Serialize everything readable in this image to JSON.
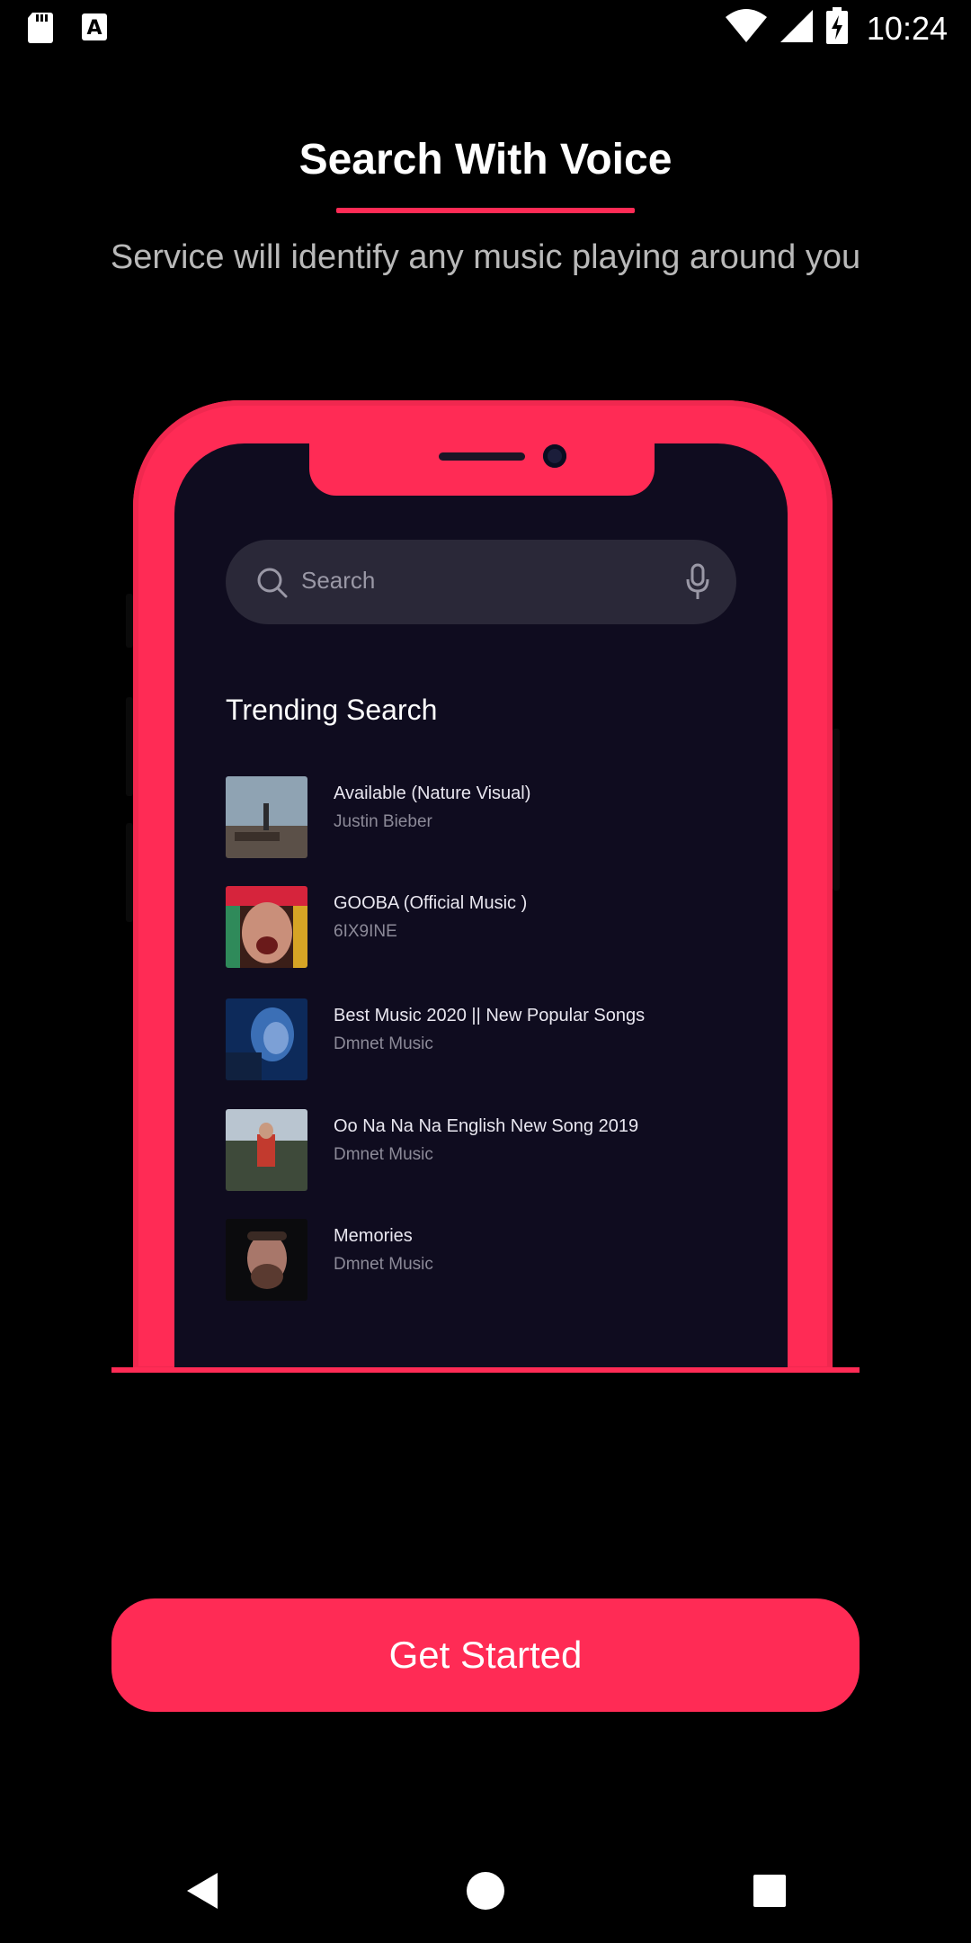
{
  "status_bar": {
    "time": "10:24",
    "icons": [
      "sd-card-icon",
      "a-notification-icon",
      "wifi-icon",
      "signal-icon",
      "battery-charging-icon"
    ]
  },
  "onboarding": {
    "title": "Search With Voice",
    "subtitle": "Service will identify any music playing around you",
    "cta_label": "Get Started"
  },
  "mockup": {
    "search_placeholder": "Search",
    "section_title": "Trending Search",
    "tracks": [
      {
        "title": "Available (Nature Visual)",
        "artist": "Justin Bieber"
      },
      {
        "title": "GOOBA (Official Music )",
        "artist": "6IX9INE"
      },
      {
        "title": "Best Music 2020 || New Popular Songs",
        "artist": "Dmnet Music"
      },
      {
        "title": "Oo Na Na Na English New Song 2019",
        "artist": "Dmnet Music"
      },
      {
        "title": "Memories",
        "artist": "Dmnet Music"
      }
    ]
  },
  "nav_bar": {
    "icons": [
      "back-icon",
      "home-icon",
      "recents-icon"
    ]
  },
  "colors": {
    "accent": "#ff2b55",
    "background": "#000000",
    "screen": "#0f0c1f"
  }
}
